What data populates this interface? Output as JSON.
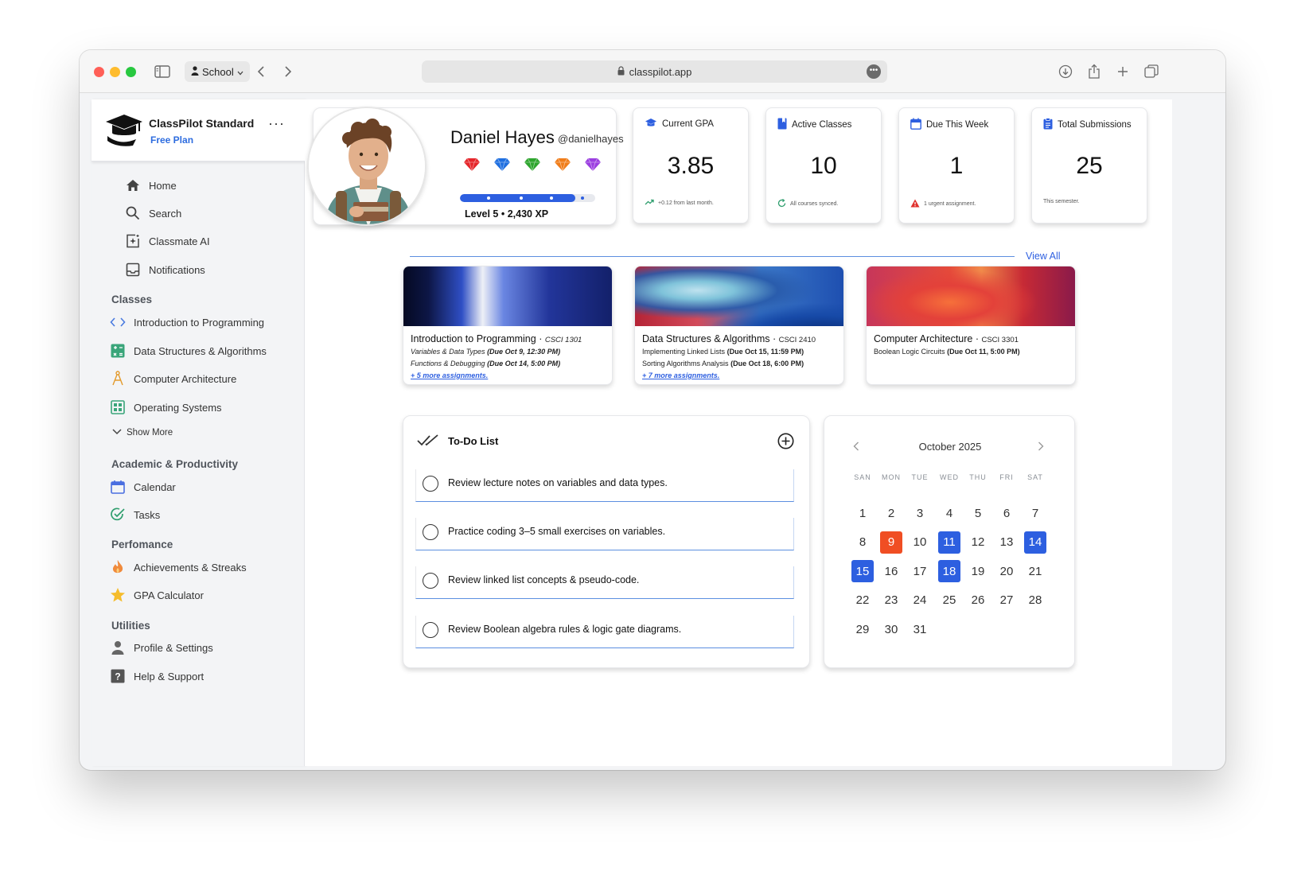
{
  "browser": {
    "profile": "School",
    "url": "classpilot.app"
  },
  "sidebar": {
    "brand_title": "ClassPilot Standard",
    "brand_plan": "Free Plan",
    "brand_more": "···",
    "main_items": [
      "Home",
      "Search",
      "Classmate AI",
      "Notifications"
    ],
    "classes_heading": "Classes",
    "classes": [
      "Introduction to Programming",
      "Data Structures & Algorithms",
      "Computer Architecture",
      "Operating Systems"
    ],
    "show_more": "Show More",
    "academic_heading": "Academic & Productivity",
    "academic": [
      "Calendar",
      "Tasks"
    ],
    "performance_heading": "Perfomance",
    "performance": [
      "Achievements & Streaks",
      "GPA Calculator"
    ],
    "utilities_heading": "Utilities",
    "utilities": [
      "Profile & Settings",
      "Help & Support"
    ]
  },
  "profile": {
    "name": "Daniel Hayes",
    "handle": "@danielhayes",
    "level_text": "Level 5 • 2,430 XP",
    "xp_progress": 0.85,
    "gem_colors": [
      "#e5262b",
      "#1f6fe0",
      "#2ea52e",
      "#f07d1a",
      "#9b3fe0"
    ]
  },
  "stats": [
    {
      "label": "Current GPA",
      "value": "3.85",
      "foot": "+0.12 from last month.",
      "color": "#2d5fe0"
    },
    {
      "label": "Active Classes",
      "value": "10",
      "foot": "All courses synced.",
      "color": "#2d5fe0"
    },
    {
      "label": "Due This Week",
      "value": "1",
      "foot": "1 urgent assignment.",
      "color": "#2d5fe0"
    },
    {
      "label": "Total Submissions",
      "value": "25",
      "foot": "This semester.",
      "color": "#2d5fe0"
    }
  ],
  "view_all": "View All",
  "courses": [
    {
      "title": "Introduction to Programming",
      "code": "CSCI 1301",
      "lines": [
        {
          "name": "Variables & Data Types",
          "due": "(Due Oct 9, 12:30 PM)"
        },
        {
          "name": "Functions & Debugging",
          "due": "(Due Oct 14, 5:00 PM)"
        }
      ],
      "more": "+ 5 more assignments."
    },
    {
      "title": "Data Structures & Algorithms",
      "code": "CSCI 2410",
      "lines": [
        {
          "name": "Implementing Linked Lists",
          "due": "(Due Oct 15, 11:59 PM)"
        },
        {
          "name": "Sorting Algorithms Analysis",
          "due": "(Due Oct 18, 6:00 PM)"
        }
      ],
      "more": "+ 7 more assignments."
    },
    {
      "title": "Computer Architecture",
      "code": "CSCI 3301",
      "lines": [
        {
          "name": "Boolean Logic Circuits",
          "due": "(Due Oct 11, 5:00 PM)"
        }
      ],
      "more": ""
    }
  ],
  "todo": {
    "title": "To-Do List",
    "items": [
      "Review lecture notes on variables and data types.",
      "Practice coding 3–5 small exercises on variables.",
      "Review linked list concepts & pseudo-code.",
      "Review Boolean algebra rules & logic gate diagrams."
    ]
  },
  "calendar": {
    "month": "October 2025",
    "weekdays": [
      "SAN",
      "MON",
      "TUE",
      "WED",
      "THU",
      "FRI",
      "SAT"
    ],
    "days": [
      "1",
      "2",
      "3",
      "4",
      "5",
      "6",
      "7",
      "8",
      "9",
      "10",
      "11",
      "12",
      "13",
      "14",
      "15",
      "16",
      "17",
      "18",
      "19",
      "20",
      "21",
      "22",
      "23",
      "24",
      "25",
      "26",
      "27",
      "28",
      "29",
      "30",
      "31"
    ],
    "today": "9",
    "highlighted": [
      "11",
      "14",
      "15",
      "18"
    ],
    "today_color": "#f04e23",
    "highlight_color": "#2d5fe0"
  }
}
